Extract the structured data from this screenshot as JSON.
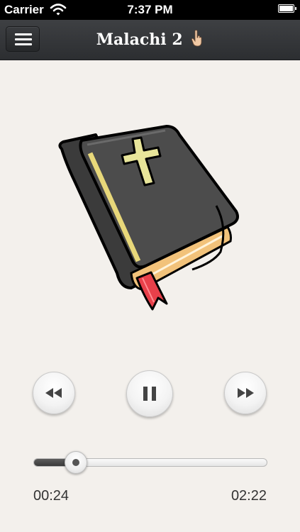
{
  "status_bar": {
    "carrier": "Carrier",
    "time": "7:37 PM",
    "icons": [
      "wifi-icon",
      "battery-icon"
    ]
  },
  "nav_bar": {
    "title": "Malachi 2",
    "menu_icon": "hamburger-menu-icon",
    "title_icon": "pointing-hand-icon"
  },
  "artwork": {
    "icon": "bible-book-icon"
  },
  "controls": {
    "rewind_icon": "rewind-icon",
    "pause_icon": "pause-icon",
    "forward_icon": "fast-forward-icon"
  },
  "progress": {
    "elapsed": "00:24",
    "total": "02:22",
    "fraction": 0.18
  },
  "colors": {
    "nav_background": "#34363a",
    "page_background": "#f3f0ec",
    "book_cover": "#4a4a4a",
    "cross": "#e8e59a",
    "pages": "#f2c27a",
    "ribbon": "#e8404a"
  }
}
